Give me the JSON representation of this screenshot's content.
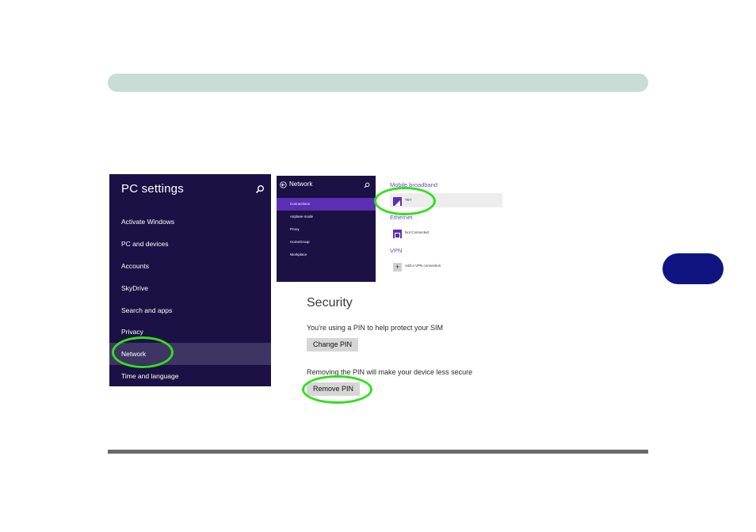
{
  "pc_settings": {
    "title": "PC settings",
    "items": [
      {
        "label": "Activate Windows"
      },
      {
        "label": "PC and devices"
      },
      {
        "label": "Accounts"
      },
      {
        "label": "SkyDrive"
      },
      {
        "label": "Search and apps"
      },
      {
        "label": "Privacy"
      },
      {
        "label": "Network",
        "selected": true
      },
      {
        "label": "Time and language"
      }
    ]
  },
  "network_nav": {
    "title": "Network",
    "items": [
      {
        "label": "Connections",
        "selected": true
      },
      {
        "label": "Airplane mode"
      },
      {
        "label": "Proxy"
      },
      {
        "label": "HomeGroup"
      },
      {
        "label": "Workplace"
      }
    ]
  },
  "network_content": {
    "mobile_broadband_heading": "Mobile broadband",
    "mobile_item_label": "TET",
    "ethernet_heading": "Ethernet",
    "ethernet_item_label": "Not Connected",
    "vpn_heading": "VPN",
    "vpn_add_label": "Add a VPN connection"
  },
  "security": {
    "title": "Security",
    "pin_text": "You're using a PIN to help protect your SIM",
    "change_pin_label": "Change PIN",
    "remove_text": "Removing the PIN will make your device less secure",
    "remove_pin_label": "Remove PIN"
  },
  "colors": {
    "panel_bg": "#1b1144",
    "accent": "#5b2fb3",
    "highlight_oval": "#31e01c",
    "chapter_tab": "#101480",
    "header_bar": "#c9dcd6"
  }
}
